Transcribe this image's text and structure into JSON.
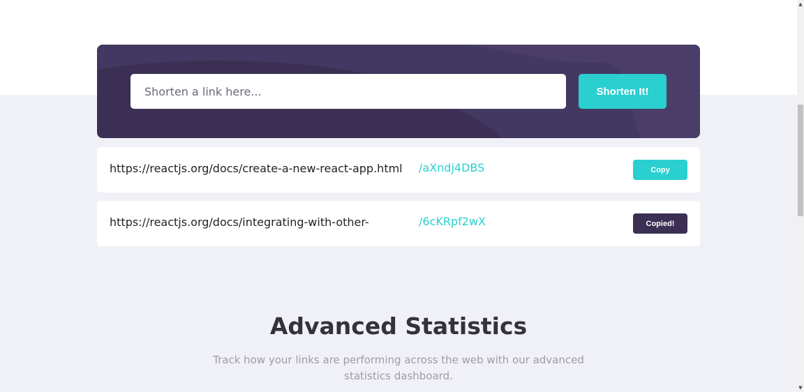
{
  "shortener": {
    "input_placeholder": "Shorten a link here...",
    "button_label": "Shorten It!"
  },
  "results": [
    {
      "original": "https://reactjs.org/docs/create-a-new-react-app.html",
      "short": "/aXndj4DBS",
      "button_label": "Copy",
      "copied": false
    },
    {
      "original": "https://reactjs.org/docs/integrating-with-other-",
      "short": "/6cKRpf2wX",
      "button_label": "Copied!",
      "copied": true
    }
  ],
  "statistics": {
    "title": "Advanced Statistics",
    "description": "Track how your links are performing across the web with our advanced statistics dashboard."
  },
  "colors": {
    "primary_cyan": "#2acfcf",
    "dark_violet": "#3b3054",
    "background": "#f0f1f6"
  },
  "icons": {
    "scroll_up": "scroll-up-arrow-icon",
    "scroll_down": "scroll-down-arrow-icon"
  }
}
